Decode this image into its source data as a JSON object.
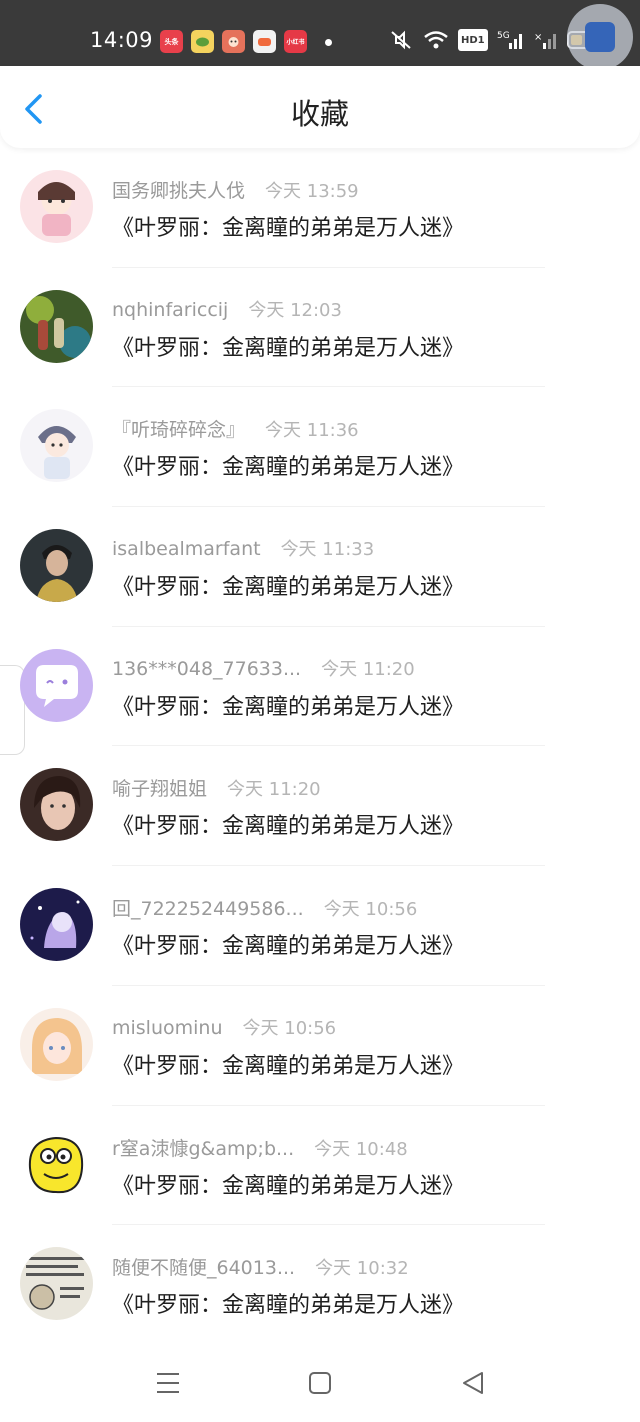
{
  "status_bar": {
    "time": "14:09",
    "apps": [
      {
        "icon": "toutiao-app-icon",
        "label": "头条",
        "color": "#e8404b"
      },
      {
        "icon": "chat-app-icon",
        "label": "",
        "color": "#f4d35e"
      },
      {
        "icon": "character-app-icon",
        "label": "",
        "color": "#e5725b"
      },
      {
        "icon": "game-app-icon",
        "label": "",
        "color": "#f2f2f2"
      },
      {
        "icon": "redbook-app-icon",
        "label": "小红书",
        "color": "#e53946"
      }
    ],
    "network": "5G",
    "hd_label": "HD1"
  },
  "header": {
    "title": "收藏",
    "back_icon": "chevron-left-icon",
    "accent": "#2196f3"
  },
  "items": [
    {
      "name": "国务卿挑夫人伐",
      "time": "今天 13:59",
      "book": "《叶罗丽：金离瞳的弟弟是万人迷》"
    },
    {
      "name": "nqhinfariccij",
      "time": "今天 12:03",
      "book": "《叶罗丽：金离瞳的弟弟是万人迷》"
    },
    {
      "name": "『听琦碎碎念』",
      "time": "今天 11:36",
      "book": "《叶罗丽：金离瞳的弟弟是万人迷》"
    },
    {
      "name": "isalbealmarfant",
      "time": "今天 11:33",
      "book": "《叶罗丽：金离瞳的弟弟是万人迷》"
    },
    {
      "name": "136***048_77633...",
      "time": "今天 11:20",
      "book": "《叶罗丽：金离瞳的弟弟是万人迷》"
    },
    {
      "name": "喻子翔姐姐",
      "time": "今天 11:20",
      "book": "《叶罗丽：金离瞳的弟弟是万人迷》"
    },
    {
      "name": "回_722252449586...",
      "time": "今天 10:56",
      "book": "《叶罗丽：金离瞳的弟弟是万人迷》"
    },
    {
      "name": "misluominu",
      "time": "今天 10:56",
      "book": "《叶罗丽：金离瞳的弟弟是万人迷》"
    },
    {
      "name": "r窒a洓慷g&amp;b...",
      "time": "今天 10:48",
      "book": "《叶罗丽：金离瞳的弟弟是万人迷》"
    },
    {
      "name": "随便不随便_64013...",
      "time": "今天 10:32",
      "book": "《叶罗丽：金离瞳的弟弟是万人迷》"
    }
  ],
  "nav": {
    "menu_icon": "menu-icon",
    "home_icon": "square-home-icon",
    "back_icon": "triangle-back-icon"
  }
}
